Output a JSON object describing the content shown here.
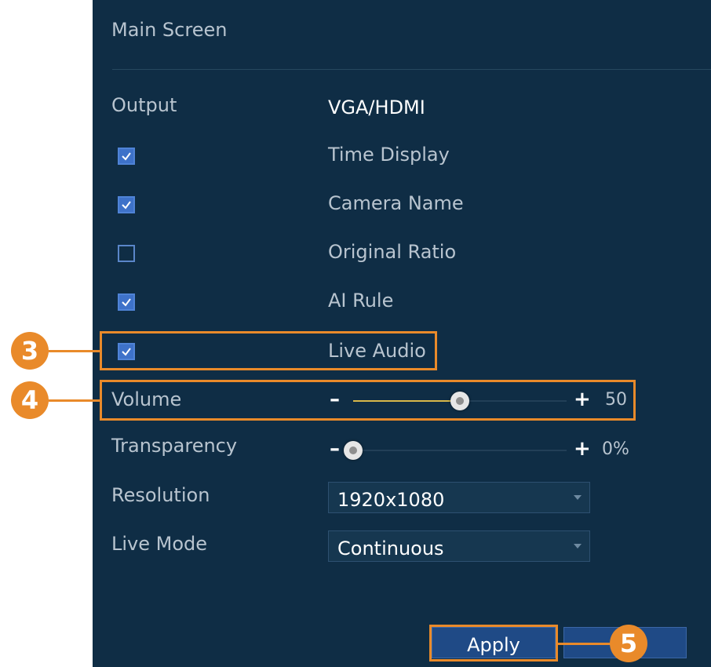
{
  "panel": {
    "title": "Main Screen"
  },
  "output": {
    "label": "Output",
    "value": "VGA/HDMI"
  },
  "checkboxes": [
    {
      "label": "Time Display",
      "checked": true
    },
    {
      "label": "Camera Name",
      "checked": true
    },
    {
      "label": "Original Ratio",
      "checked": false
    },
    {
      "label": "AI Rule",
      "checked": true
    },
    {
      "label": "Live Audio",
      "checked": true
    }
  ],
  "volume": {
    "label": "Volume",
    "minus": "–",
    "plus": "+",
    "value_text": "50",
    "level": 50
  },
  "transparency": {
    "label": "Transparency",
    "minus": "–",
    "plus": "+",
    "value_text": "0%",
    "level": 0
  },
  "resolution": {
    "label": "Resolution",
    "selected": "1920x1080"
  },
  "live_mode": {
    "label": "Live Mode",
    "selected": "Continuous"
  },
  "buttons": {
    "apply": "Apply"
  },
  "callouts": [
    "3",
    "4",
    "5"
  ],
  "colors": {
    "panel": "#0f2d45",
    "highlight": "#e98a2a",
    "button": "#1f4a86",
    "slider_fill": "#d8b84a"
  }
}
